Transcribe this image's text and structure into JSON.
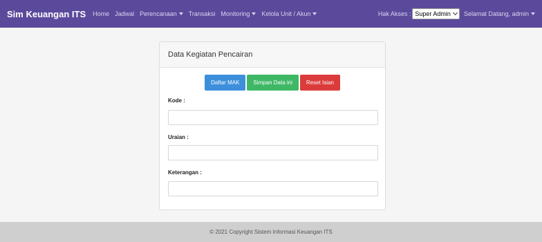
{
  "navbar": {
    "brand": "Sim Keuangan ITS",
    "items": [
      {
        "label": "Home",
        "dropdown": false
      },
      {
        "label": "Jadwal",
        "dropdown": false
      },
      {
        "label": "Perencanaan",
        "dropdown": true
      },
      {
        "label": "Transaksi",
        "dropdown": false
      },
      {
        "label": "Monitoring",
        "dropdown": true
      },
      {
        "label": "Kelola Unit / Akun",
        "dropdown": true
      }
    ],
    "access_label": "Hak Akses :",
    "access_value": "Super Admin",
    "welcome": "Selamat Datang, admin"
  },
  "card": {
    "title": "Data Kegiatan Pencairan",
    "buttons": {
      "daftar_mak": "Daftar MAK",
      "simpan": "Simpan Data ini",
      "reset": "Reset Isian"
    },
    "fields": {
      "kode_label": "Kode :",
      "kode_value": "",
      "uraian_label": "Uraian :",
      "uraian_value": "",
      "keterangan_label": "Keterangan :",
      "keterangan_value": ""
    }
  },
  "footer": {
    "text": "© 2021 Copyright Sistem Informasi Keuangan ITS"
  },
  "colors": {
    "navbar": "#5b4a9c",
    "btn_blue": "#3d8fdb",
    "btn_green": "#3fb866",
    "btn_red": "#dc3b3b",
    "footer": "#cfcfcf"
  }
}
